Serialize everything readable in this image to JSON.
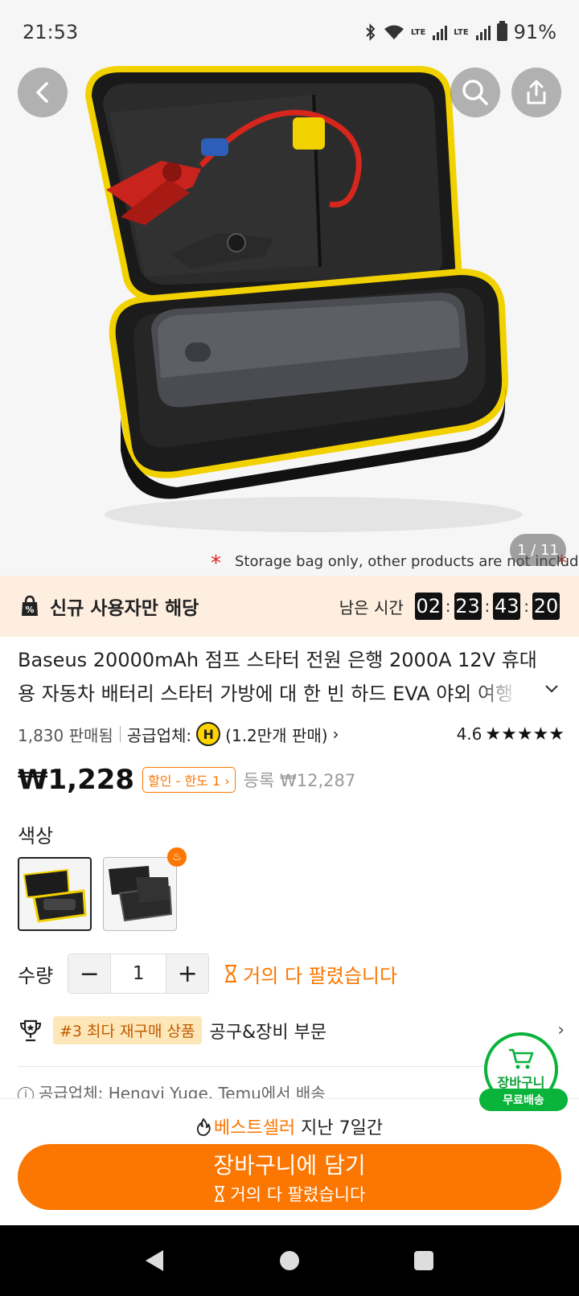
{
  "status_bar": {
    "time": "21:53",
    "battery": "91%",
    "network_1": "LTE",
    "network_2": "LTE"
  },
  "hero": {
    "image_counter": "1 / 11",
    "caption": "Storage bag only, other products are not included",
    "back_icon": "chevron-left-icon",
    "search_icon": "search-icon",
    "share_icon": "share-icon"
  },
  "promo": {
    "label": "신규 사용자만 해당",
    "timer_label": "남은 시간",
    "hours": "02",
    "minutes": "23",
    "seconds": "43",
    "centis": "20"
  },
  "product": {
    "title": "Baseus 20000mAh 점프 스타터 전원 은행 2000A 12V 휴대용 자동차 배터리 스타터 가방에 대 한 빈 하드 EVA 야외 여행 케이스",
    "sold": "1,830 판매됨",
    "supplier_label": "공급업체:",
    "supplier_badge": "H",
    "supplier_sales": "(1.2만개 판매)",
    "rating": "4.6",
    "stars": "★★★★★",
    "price": "₩1,228",
    "discount_tag": "할인 - 한도 1 ›",
    "original_price": "등록 ₩12,287",
    "color_label": "색상",
    "qty_label": "수량",
    "qty_value": "1",
    "almost_sold": "거의 다 팔렸습니다",
    "rank_badge": "#3 최다 재구매 상품",
    "rank_category": "공구&장비 부문",
    "supplier_line": "공급업체: Hengyi Yuge. Temu에서 배송"
  },
  "floating_cart": {
    "label": "장바구니",
    "shipping": "무료배송"
  },
  "bottom": {
    "bestseller_orange": "베스트셀러",
    "bestseller_rest": "지난 7일간",
    "cta_main": "장바구니에 담기",
    "cta_sub": "거의 다 팔렸습니다"
  },
  "colors": {
    "accent": "#fb7701",
    "green": "#0ab33a",
    "promo_bg": "#fdeee0"
  }
}
